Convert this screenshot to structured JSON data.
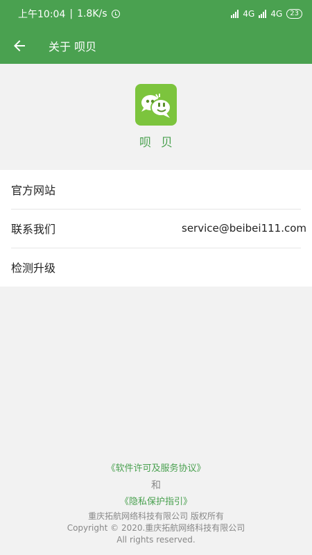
{
  "status_bar": {
    "time": "上午10:04",
    "separator": "|",
    "speed": "1.8K/s",
    "net1": "4G",
    "net2": "4G",
    "battery": "23"
  },
  "app_bar": {
    "title": "关于 呗贝"
  },
  "app": {
    "name": "呗贝",
    "icon_color": "#7cc43d"
  },
  "list": [
    {
      "label": "官方网站",
      "value": ""
    },
    {
      "label": "联系我们",
      "value": "service@beibei111.com"
    },
    {
      "label": "检测升级",
      "value": ""
    }
  ],
  "footer": {
    "license_link": "《软件许可及服务协议》",
    "and": "和",
    "privacy_link": "《隐私保护指引》",
    "company_line": "重庆拓航网络科技有限公司 版权所有",
    "copyright_line": "Copyright © 2020.重庆拓航网络科技有限公司",
    "rights_line": "All rights reserved."
  },
  "colors": {
    "primary": "#4aa150",
    "background": "#f2f2f2"
  }
}
